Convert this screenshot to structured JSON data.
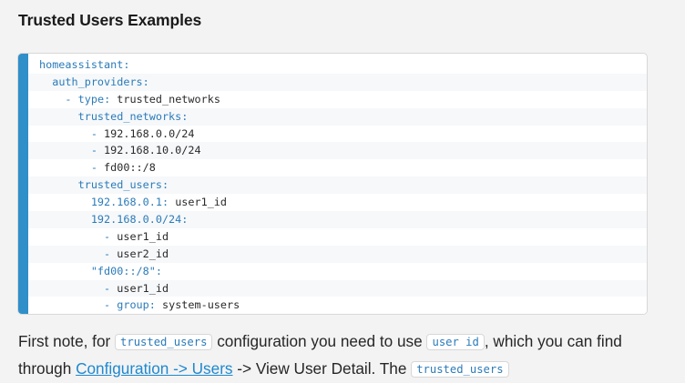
{
  "heading": "Trusted Users Examples",
  "code": [
    {
      "indent": "",
      "dash": "",
      "key": "homeassistant",
      "sep": ":",
      "value": ""
    },
    {
      "indent": "  ",
      "dash": "",
      "key": "auth_providers",
      "sep": ":",
      "value": ""
    },
    {
      "indent": "    ",
      "dash": "- ",
      "key": "type",
      "sep": ": ",
      "value": "trusted_networks"
    },
    {
      "indent": "      ",
      "dash": "",
      "key": "trusted_networks",
      "sep": ":",
      "value": ""
    },
    {
      "indent": "        ",
      "dash": "- ",
      "key": "",
      "sep": "",
      "value": "192.168.0.0/24"
    },
    {
      "indent": "        ",
      "dash": "- ",
      "key": "",
      "sep": "",
      "value": "192.168.10.0/24"
    },
    {
      "indent": "        ",
      "dash": "- ",
      "key": "",
      "sep": "",
      "value": "fd00::/8"
    },
    {
      "indent": "      ",
      "dash": "",
      "key": "trusted_users",
      "sep": ":",
      "value": ""
    },
    {
      "indent": "        ",
      "dash": "",
      "key": "192.168.0.1",
      "sep": ": ",
      "value": "user1_id"
    },
    {
      "indent": "        ",
      "dash": "",
      "key": "192.168.0.0/24",
      "sep": ":",
      "value": ""
    },
    {
      "indent": "          ",
      "dash": "- ",
      "key": "",
      "sep": "",
      "value": "user1_id"
    },
    {
      "indent": "          ",
      "dash": "- ",
      "key": "",
      "sep": "",
      "value": "user2_id"
    },
    {
      "indent": "        ",
      "dash": "",
      "key": "\"fd00::/8\"",
      "sep": ":",
      "value": ""
    },
    {
      "indent": "          ",
      "dash": "- ",
      "key": "",
      "sep": "",
      "value": "user1_id"
    },
    {
      "indent": "          ",
      "dash": "- ",
      "key": "group",
      "sep": ": ",
      "value": "system-users"
    }
  ],
  "prose": {
    "t1": "First note, for ",
    "code1": "trusted_users",
    "t2": " configuration you need to use ",
    "code2": "user id",
    "t3": ", which you can find through ",
    "link": "Configuration -> Users",
    "t4": " -> View User Detail. The ",
    "code3": "trusted_users"
  }
}
